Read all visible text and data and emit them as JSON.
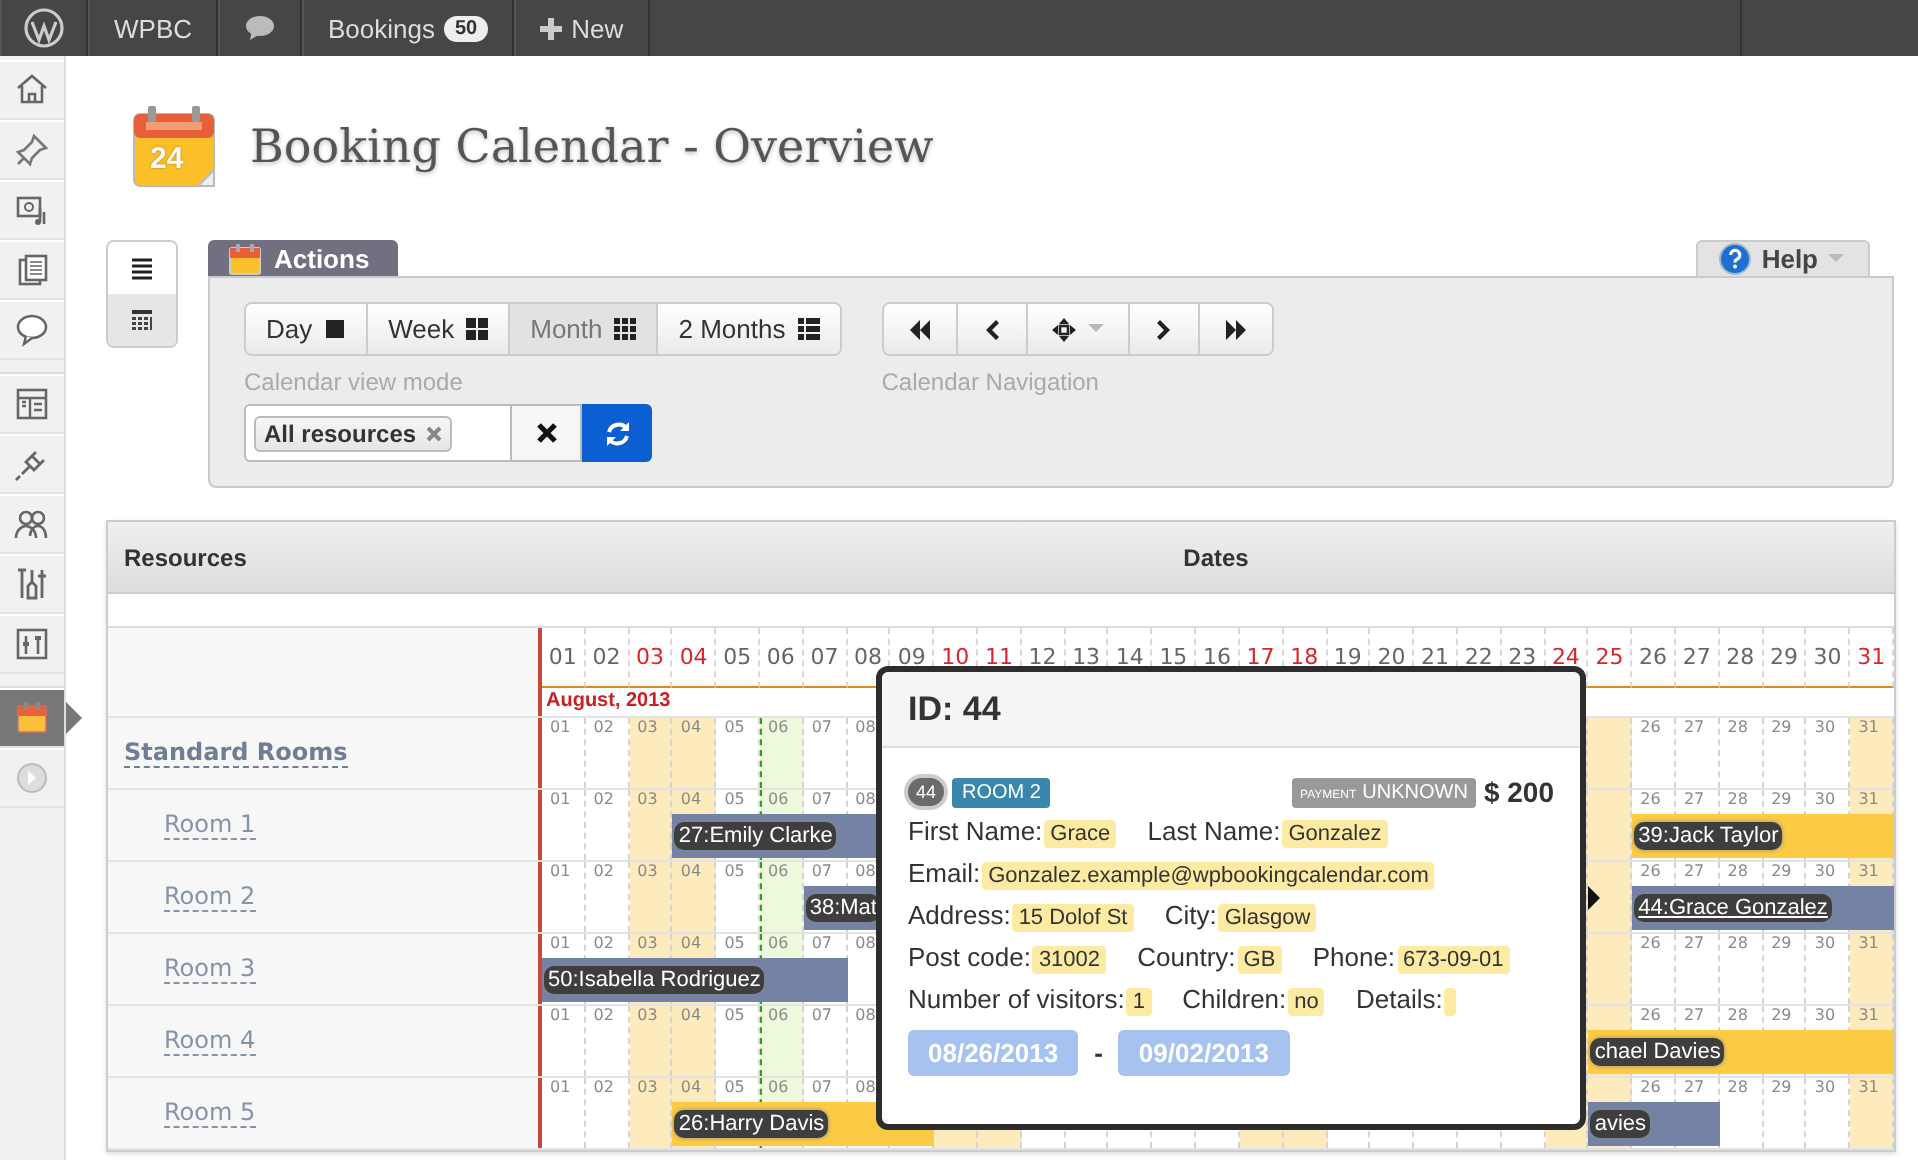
{
  "top_bar": {
    "site": "WPBC",
    "bookings": "Bookings",
    "bookings_count": "50",
    "new": "New"
  },
  "admin_menu": [
    {
      "selected": false
    },
    {
      "selected": false
    },
    {
      "selected": false
    },
    {
      "selected": false
    },
    {
      "selected": false
    },
    {
      "selected": false
    },
    {
      "selected": false
    },
    {
      "selected": false
    },
    {
      "selected": false
    },
    {
      "selected": false
    },
    {
      "selected": true
    },
    {
      "selected": false
    }
  ],
  "page": {
    "title": "Booking Calendar - Overview",
    "icon_day": "24"
  },
  "view_toggle": [
    {
      "selected": false
    },
    {
      "selected": true
    }
  ],
  "actions": {
    "tab": "Actions",
    "help": "Help",
    "view_modes": [
      {
        "label": "Day",
        "selected": false
      },
      {
        "label": "Week",
        "selected": false
      },
      {
        "label": "Month",
        "selected": true
      },
      {
        "label": "2 Months",
        "selected": false
      }
    ],
    "view_mode_caption": "Calendar view mode",
    "resource_chip": "All resources",
    "navigation_caption": "Calendar Navigation"
  },
  "grid": {
    "columns": [
      "Resources",
      "Dates"
    ],
    "month": "August, 2013",
    "days": [
      {
        "label": "01",
        "weekend": false,
        "today": false
      },
      {
        "label": "02",
        "weekend": false,
        "today": false
      },
      {
        "label": "03",
        "weekend": true,
        "today": false
      },
      {
        "label": "04",
        "weekend": true,
        "today": false
      },
      {
        "label": "05",
        "weekend": false,
        "today": false
      },
      {
        "label": "06",
        "weekend": false,
        "today": true
      },
      {
        "label": "07",
        "weekend": false,
        "today": false
      },
      {
        "label": "08",
        "weekend": false,
        "today": false
      },
      {
        "label": "09",
        "weekend": false,
        "today": false
      },
      {
        "label": "10",
        "weekend": true,
        "today": false
      },
      {
        "label": "11",
        "weekend": true,
        "today": false
      },
      {
        "label": "12",
        "weekend": false,
        "today": false
      },
      {
        "label": "13",
        "weekend": false,
        "today": false
      },
      {
        "label": "14",
        "weekend": false,
        "today": false
      },
      {
        "label": "15",
        "weekend": false,
        "today": false
      },
      {
        "label": "16",
        "weekend": false,
        "today": false
      },
      {
        "label": "17",
        "weekend": true,
        "today": false
      },
      {
        "label": "18",
        "weekend": true,
        "today": false
      },
      {
        "label": "19",
        "weekend": false,
        "today": false
      },
      {
        "label": "20",
        "weekend": false,
        "today": false
      },
      {
        "label": "21",
        "weekend": false,
        "today": false
      },
      {
        "label": "22",
        "weekend": false,
        "today": false
      },
      {
        "label": "23",
        "weekend": false,
        "today": false
      },
      {
        "label": "24",
        "weekend": true,
        "today": false
      },
      {
        "label": "25",
        "weekend": true,
        "today": false
      },
      {
        "label": "26",
        "weekend": false,
        "today": false
      },
      {
        "label": "27",
        "weekend": false,
        "today": false
      },
      {
        "label": "28",
        "weekend": false,
        "today": false
      },
      {
        "label": "29",
        "weekend": false,
        "today": false
      },
      {
        "label": "30",
        "weekend": false,
        "today": false
      },
      {
        "label": "31",
        "weekend": true,
        "today": false
      }
    ],
    "resources": [
      {
        "name": "Standard Rooms",
        "kind": "group",
        "marks_start": [
          "01",
          "02",
          "03",
          "04",
          "05",
          "06",
          "07",
          "08"
        ],
        "marks_end": [
          "26",
          "27",
          "28",
          "29",
          "30",
          "31"
        ]
      },
      {
        "name": "Room 1",
        "kind": "room",
        "marks_start": [
          "01",
          "02",
          "03",
          "04",
          "05",
          "06",
          "07",
          "08"
        ],
        "marks_end": [
          "26",
          "27",
          "28",
          "29",
          "30",
          "31"
        ],
        "bookings": [
          {
            "label": "27:Emily Clarke",
            "kind": "approved",
            "selected": false
          },
          {
            "label": "39:Jack Taylor",
            "kind": "pending",
            "selected": false
          }
        ]
      },
      {
        "name": "Room 2",
        "kind": "room",
        "marks_start": [
          "01",
          "02",
          "03",
          "04",
          "05",
          "06",
          "07",
          "08"
        ],
        "marks_end": [
          "26",
          "27",
          "28",
          "29",
          "30",
          "31"
        ],
        "bookings": [
          {
            "label": "38:Mat",
            "kind": "approved",
            "selected": false
          },
          {
            "label": "44:Grace Gonzalez",
            "kind": "approved",
            "selected": true
          }
        ]
      },
      {
        "name": "Room 3",
        "kind": "room",
        "marks_start": [
          "01",
          "02",
          "03",
          "04",
          "05",
          "06",
          "07",
          "08"
        ],
        "marks_end": [
          "26",
          "27",
          "28",
          "29",
          "30",
          "31"
        ],
        "bookings": [
          {
            "label": "50:Isabella Rodriguez",
            "kind": "approved",
            "selected": false
          }
        ]
      },
      {
        "name": "Room 4",
        "kind": "room",
        "marks_start": [
          "01",
          "02",
          "03",
          "04",
          "05",
          "06",
          "07",
          "08"
        ],
        "marks_end": [
          "26",
          "27",
          "28",
          "29",
          "30",
          "31"
        ],
        "bookings": [
          {
            "label": "chael Davies",
            "kind": "pending",
            "selected": false
          }
        ]
      },
      {
        "name": "Room 5",
        "kind": "room",
        "marks_start": [
          "01",
          "02",
          "03",
          "04",
          "05",
          "06",
          "07",
          "08"
        ],
        "marks_end": [
          "26",
          "27",
          "28",
          "29",
          "30",
          "31"
        ],
        "bookings": [
          {
            "label": "26:Harry Davis",
            "kind": "pending",
            "selected": false
          },
          {
            "label": "avies",
            "kind": "approved",
            "selected": false
          }
        ]
      }
    ]
  },
  "popup": {
    "title": "ID: 44",
    "id_badge": "44",
    "resource_tag": "ROOM 2",
    "payment_prefix": "PAYMENT",
    "payment_status": "UNKNOWN",
    "cost": "$ 200",
    "fields": [
      {
        "label": "First Name:",
        "value": "Grace"
      },
      {
        "label": "Last Name:",
        "value": "Gonzalez"
      },
      {
        "label": "Email:",
        "value": "Gonzalez.example@wpbookingcalendar.com"
      },
      {
        "label": "Address:",
        "value": "15 Dolof St"
      },
      {
        "label": "City:",
        "value": "Glasgow"
      },
      {
        "label": "Post code:",
        "value": "31002"
      },
      {
        "label": "Country:",
        "value": "GB"
      },
      {
        "label": "Phone:",
        "value": "673-09-01"
      },
      {
        "label": "Number of visitors:",
        "value": "1"
      },
      {
        "label": "Children:",
        "value": "no"
      },
      {
        "label": "Details:"
      }
    ],
    "date_from": "08/26/2013",
    "date_separator": "-",
    "date_to": "09/02/2013"
  }
}
